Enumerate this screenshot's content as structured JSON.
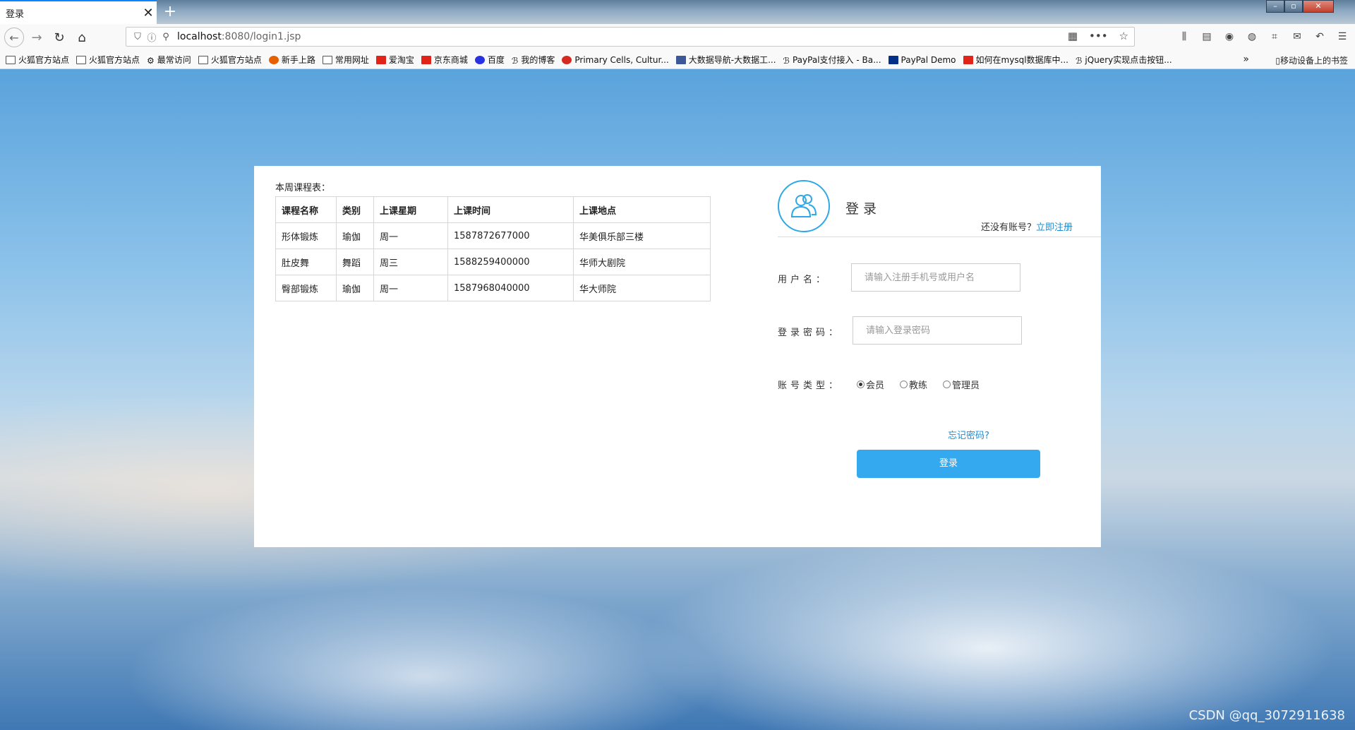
{
  "browser": {
    "tab_title": "登录",
    "tab_close": "✕",
    "new_tab": "+",
    "url_host": "localhost",
    "url_path": ":8080/login1.jsp",
    "bookmarks": [
      {
        "label": "火狐官方站点",
        "icon": "folder"
      },
      {
        "label": "火狐官方站点",
        "icon": "folder"
      },
      {
        "label": "最常访问",
        "icon": "gear"
      },
      {
        "label": "火狐官方站点",
        "icon": "folder"
      },
      {
        "label": "新手上路",
        "icon": "firefox"
      },
      {
        "label": "常用网址",
        "icon": "folder"
      },
      {
        "label": "爱淘宝",
        "icon": "taobao"
      },
      {
        "label": "京东商城",
        "icon": "jd"
      },
      {
        "label": "百度",
        "icon": "baidu"
      },
      {
        "label": "我的博客",
        "icon": "blog"
      },
      {
        "label": "Primary Cells, Cultur...",
        "icon": "site"
      },
      {
        "label": "大数据导航-大数据工...",
        "icon": "site"
      },
      {
        "label": "PayPal支付接入 - Ba...",
        "icon": "blog"
      },
      {
        "label": "PayPal Demo",
        "icon": "paypal"
      },
      {
        "label": "如何在mysql数据库中...",
        "icon": "csdn"
      },
      {
        "label": "jQuery实现点击按钮...",
        "icon": "blog"
      }
    ],
    "bookmarks_more": "»",
    "mobile_bookmarks": "移动设备上的书签"
  },
  "schedule": {
    "title": "本周课程表：",
    "headers": [
      "课程名称",
      "类别",
      "上课星期",
      "上课时间",
      "上课地点"
    ],
    "rows": [
      [
        "形体锻炼",
        "瑜伽",
        "周一",
        "1587872677000",
        "华美俱乐部三楼"
      ],
      [
        "肚皮舞",
        "舞蹈",
        "周三",
        "1588259400000",
        "华师大剧院"
      ],
      [
        "臀部锻炼",
        "瑜伽",
        "周一",
        "1587968040000",
        "华大师院"
      ]
    ]
  },
  "login": {
    "title": "登录",
    "register_hint": "还没有账号？",
    "register_link": "立即注册",
    "username_label": "用户名：",
    "username_placeholder": "请输入注册手机号或用户名",
    "password_label": "登录密码：",
    "password_placeholder": "请输入登录密码",
    "account_type_label": "账号类型：",
    "account_types": [
      "会员",
      "教练",
      "管理员"
    ],
    "account_type_selected": "会员",
    "forgot_password": "忘记密码?",
    "submit": "登录"
  },
  "watermark": "CSDN @qq_3072911638",
  "colors": {
    "accent": "#35a9f0",
    "link": "#1e8ccf",
    "avatar_ring": "#2ea8e6"
  }
}
